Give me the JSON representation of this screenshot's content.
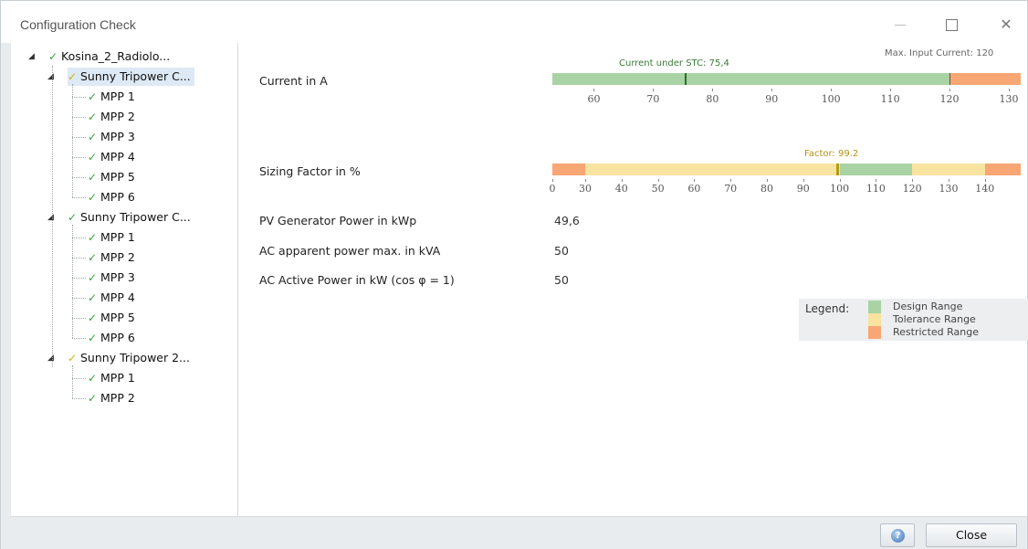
{
  "window": {
    "title": "Configuration Check",
    "minimize_glyph": "",
    "maximize_glyph": "",
    "close_glyph": "✕"
  },
  "tree": {
    "root": {
      "label": "Kosina_2_Radiolo...",
      "status": "ok"
    },
    "inverters": [
      {
        "label": "Sunny Tripower C...",
        "status": "warning",
        "selected": true,
        "mpps": [
          "MPP 1",
          "MPP 2",
          "MPP 3",
          "MPP 4",
          "MPP 5",
          "MPP 6"
        ]
      },
      {
        "label": "Sunny Tripower C...",
        "status": "ok",
        "selected": false,
        "mpps": [
          "MPP 1",
          "MPP 2",
          "MPP 3",
          "MPP 4",
          "MPP 5",
          "MPP 6"
        ]
      },
      {
        "label": "Sunny Tripower 2...",
        "status": "warning",
        "selected": false,
        "mpps": [
          "MPP 1",
          "MPP 2"
        ]
      }
    ],
    "check_glyph": "✓",
    "expand_glyph": "◢"
  },
  "current": {
    "label": "Current in A",
    "annotation": "Current under STC: 75,4",
    "max_annotation": "Max. Input Current: 120",
    "ticks": [
      "60",
      "70",
      "80",
      "90",
      "100",
      "110",
      "120",
      "130"
    ],
    "design_range": [
      53,
      120
    ],
    "restricted_range": [
      126,
      132
    ],
    "stc_value": 75.4,
    "max_value": 120
  },
  "sizing": {
    "label": "Sizing Factor in %",
    "annotation": "Factor: 99.2",
    "ticks": [
      "0",
      "30",
      "40",
      "50",
      "60",
      "70",
      "80",
      "90",
      "100",
      "110",
      "120",
      "130",
      "140"
    ],
    "factor_value": 99.2
  },
  "rows": [
    {
      "label": "PV Generator Power in kWp",
      "value": "49,6"
    },
    {
      "label": "AC apparent power max. in kVA",
      "value": "50"
    },
    {
      "label": "AC Active Power in kW (cos φ = 1)",
      "value": "50"
    }
  ],
  "legend": {
    "title": "Legend:",
    "items": [
      {
        "label": "Design Range",
        "color": "#a9d3a4"
      },
      {
        "label": "Tolerance Range",
        "color": "#f8e3a0"
      },
      {
        "label": "Restricted Range",
        "color": "#f7a674"
      }
    ]
  },
  "colors": {
    "design": "#a9d3a4",
    "tolerance": "#f8e3a0",
    "restricted": "#f7a674",
    "stc_marker": "#2e6b2e",
    "factor_marker": "#b89a10",
    "annotation_green": "#3a7a3a",
    "annotation_yellow": "#b39312"
  },
  "footer": {
    "help_icon": "help-icon",
    "close_label": "Close"
  }
}
